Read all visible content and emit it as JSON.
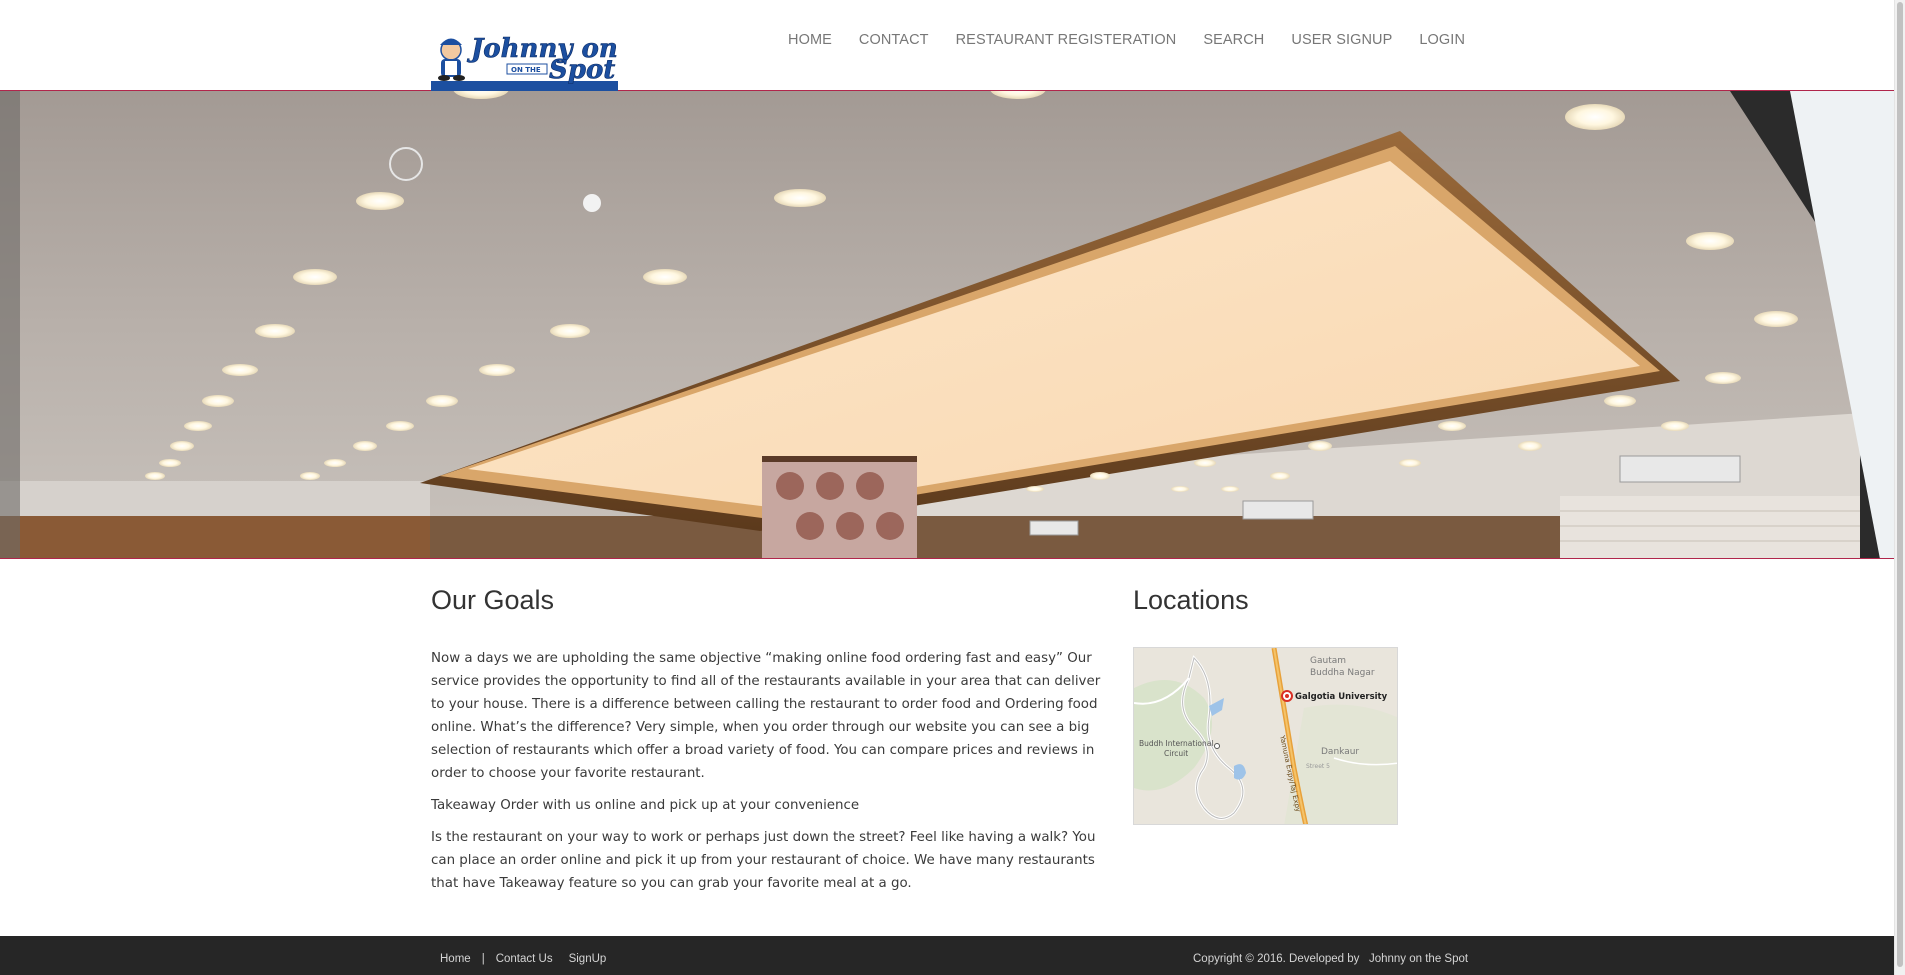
{
  "header": {
    "logo_text": "Johnny on the Spot",
    "nav": [
      {
        "label": "HOME"
      },
      {
        "label": "CONTACT"
      },
      {
        "label": "RESTAURANT REGISTERATION"
      },
      {
        "label": "SEARCH"
      },
      {
        "label": "USER SIGNUP"
      },
      {
        "label": "LOGIN"
      }
    ]
  },
  "hero": {
    "image": "restaurant-ceiling-photo"
  },
  "goals": {
    "title": "Our Goals",
    "paragraphs": [
      "Now a days we are upholding the same objective “making online food ordering fast and easy” Our service provides the opportunity to find all of the restaurants available in your area that can deliver to your house. There is a difference between calling the restaurant to order food and Ordering food online. What’s the difference? Very simple, when you order through our website you can see a big selection of restaurants which offer a broad variety of food. You can compare prices and reviews in order to choose your favorite restaurant.",
      "Takeaway Order with us online and pick up at your convenience",
      "Is the restaurant on your way to work or perhaps just down the street? Feel like having a walk? You can place an order online and pick it up from your restaurant of choice. We have many restaurants that have Takeaway feature so you can grab your favorite meal at a go."
    ]
  },
  "locations": {
    "title": "Locations",
    "map_labels": {
      "place1_line1": "Gautam",
      "place1_line2": "Buddha Nagar",
      "marker": "Galgotia University",
      "circuit_line1": "Buddh International",
      "circuit_line2": "Circuit",
      "place2": "Dankaur",
      "street": "Street 5",
      "road": "Yamuna Expy/Taj Expy"
    }
  },
  "footer": {
    "links": [
      "Home",
      "Contact Us",
      "SignUp"
    ],
    "separator": "|",
    "copyright": "Copyright © 2016. Developed by   Johnny on the Spot"
  },
  "colors": {
    "accent": "#b0264b",
    "footer_bg": "#262626",
    "nav_text": "#777777",
    "logo_blue": "#1c4fa0"
  }
}
